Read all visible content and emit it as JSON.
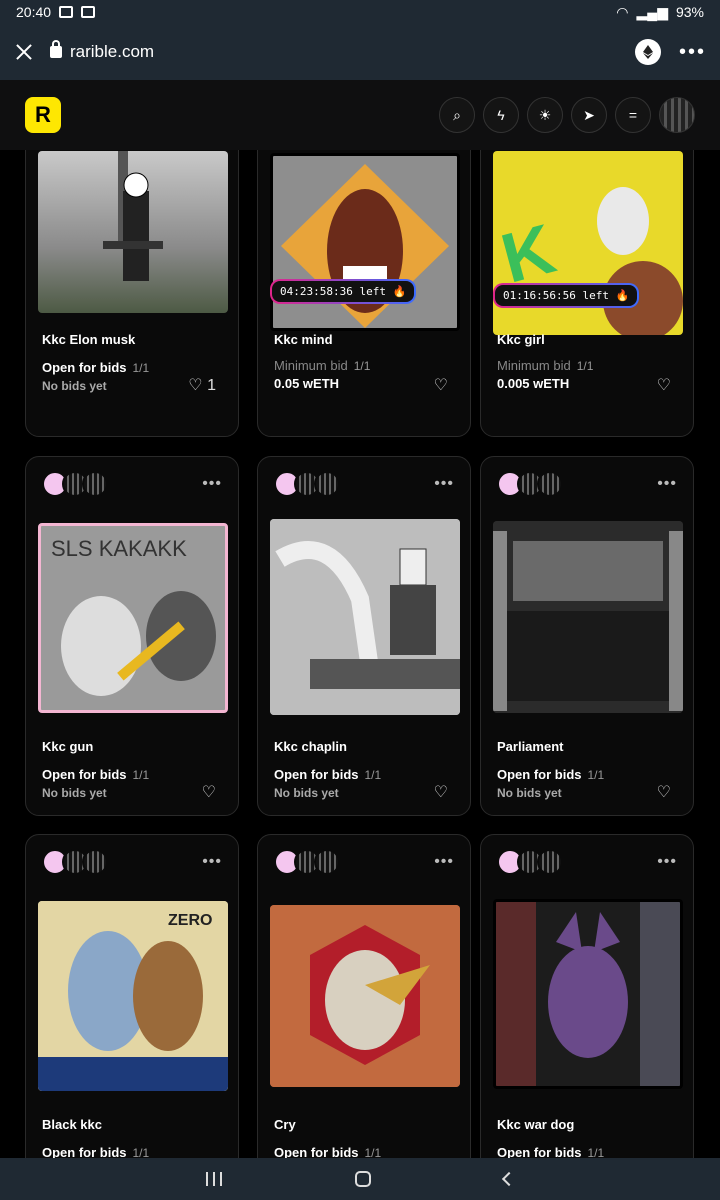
{
  "status_bar": {
    "time": "20:40",
    "battery": "93%"
  },
  "browser": {
    "url": "rarible.com"
  },
  "header": {
    "logo_letter": "R"
  },
  "cards": [
    {
      "title": "Kkc Elon musk",
      "status": "Open for bids",
      "edition": "1/1",
      "sub": "No bids yet",
      "likes": "1",
      "timer": ""
    },
    {
      "title": "Kkc mind",
      "status": "Minimum bid",
      "edition": "1/1",
      "sub": "0.05 wETH",
      "likes": "",
      "timer": "04:23:58:36 left 🔥"
    },
    {
      "title": "Kkc girl",
      "status": "Minimum bid",
      "edition": "1/1",
      "sub": "0.005 wETH",
      "likes": "",
      "timer": "01:16:56:56 left 🔥"
    },
    {
      "title": "Kkc gun",
      "status": "Open for bids",
      "edition": "1/1",
      "sub": "No bids yet",
      "likes": "",
      "timer": ""
    },
    {
      "title": "Kkc chaplin",
      "status": "Open for bids",
      "edition": "1/1",
      "sub": "No bids yet",
      "likes": "",
      "timer": ""
    },
    {
      "title": "Parliament",
      "status": "Open for bids",
      "edition": "1/1",
      "sub": "No bids yet",
      "likes": "",
      "timer": ""
    },
    {
      "title": "Black kkc",
      "status": "Open for bids",
      "edition": "1/1",
      "sub": "",
      "likes": "",
      "timer": ""
    },
    {
      "title": "Cry",
      "status": "Open for bids",
      "edition": "1/1",
      "sub": "",
      "likes": "",
      "timer": ""
    },
    {
      "title": "Kkc war dog",
      "status": "Open for bids",
      "edition": "1/1",
      "sub": "",
      "likes": "",
      "timer": ""
    }
  ],
  "colors": {
    "accent": "#fee702",
    "card_bg": "#0a0a0a",
    "chrome": "#1f2933"
  }
}
